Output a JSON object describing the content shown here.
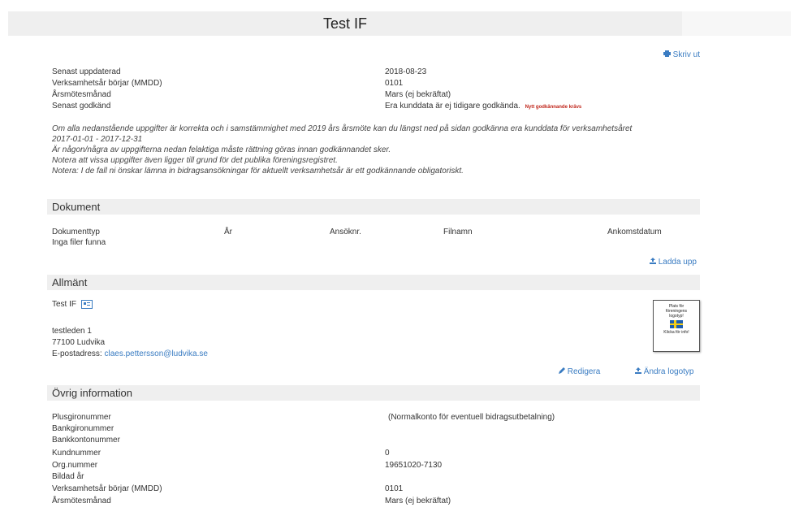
{
  "header": {
    "title": "Test IF"
  },
  "print_label": "Skriv ut",
  "summary": [
    {
      "label": "Senast uppdaterad",
      "value": "2018-08-23"
    },
    {
      "label": "Verksamhetsår börjar (MMDD)",
      "value": "0101"
    },
    {
      "label": "Årsmötesmånad",
      "value": "Mars (ej bekräftat)"
    },
    {
      "label": "Senast godkänd",
      "value": "Era kunddata är ej tidigare godkända.",
      "badge": "Nytt godkännande krävs"
    }
  ],
  "notes": [
    "Om alla nedanstående uppgifter är korrekta och i samstämmighet med 2019 års årsmöte kan du längst ned på sidan godkänna era kunddata för verksamhetsåret",
    "2017-01-01 - 2017-12-31",
    "Är någon/några av uppgifterna nedan felaktiga måste rättning göras innan godkännandet sker.",
    "Notera att vissa uppgifter även ligger till grund för det publika föreningsregistret.",
    "Notera: I de fall ni önskar lämna in bidragsansökningar för aktuellt verksamhetsår är ett godkännande obligatoriskt."
  ],
  "documents": {
    "heading": "Dokument",
    "columns": [
      "Dokumenttyp",
      "År",
      "Ansöknr.",
      "Filnamn",
      "Ankomstdatum"
    ],
    "empty": "Inga filer funna",
    "upload_label": "Ladda upp"
  },
  "general": {
    "heading": "Allmänt",
    "name": "Test IF",
    "address": "testleden 1",
    "postal": "77100 Ludvika",
    "email_label": "E-postadress:",
    "email": "claes.pettersson@ludvika.se",
    "logo_text": [
      "Plats för",
      "föreningens",
      "logotyp!"
    ],
    "logo_click": "Klicka för info!",
    "edit_label": "Redigera",
    "change_logo_label": "Ändra logotyp"
  },
  "other": {
    "heading": "Övrig information",
    "rows": [
      {
        "label": "Plusgironummer",
        "value": "(Normalkonto för eventuell bidragsutbetalning)"
      },
      {
        "label": "Bankgironummer",
        "value": ""
      },
      {
        "label": "Bankkontonummer",
        "value": ""
      },
      {
        "label": "Kundnummer",
        "value": "0"
      },
      {
        "label": "Org.nummer",
        "value": "19651020-7130"
      },
      {
        "label": "Bildad år",
        "value": ""
      },
      {
        "label": "Verksamhetsår börjar (MMDD)",
        "value": "0101"
      },
      {
        "label": "Årsmötesmånad",
        "value": "Mars (ej bekräftat)"
      }
    ]
  }
}
